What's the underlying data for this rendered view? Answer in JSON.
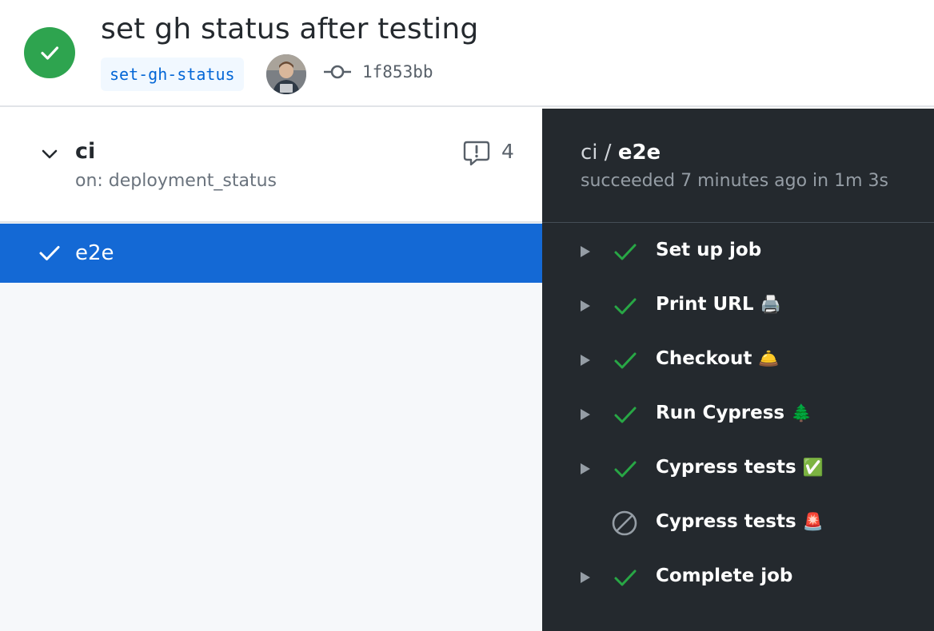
{
  "run": {
    "title": "set gh status after testing",
    "branch": "set-gh-status",
    "commit_sha": "1f853bb",
    "status": "success",
    "status_color": "#2ea44f"
  },
  "workflow": {
    "name": "ci",
    "trigger": "on: deployment_status",
    "annotation_count": "4",
    "jobs": [
      {
        "name": "e2e",
        "status": "success",
        "selected": true
      }
    ]
  },
  "job_detail": {
    "workflow_name": "ci",
    "separator": "/",
    "job_name": "e2e",
    "summary": "succeeded 7 minutes ago in 1m 3s",
    "steps": [
      {
        "name": "Set up job",
        "emoji": "",
        "status": "success",
        "expandable": true
      },
      {
        "name": "Print URL",
        "emoji": "🖨️",
        "status": "success",
        "expandable": true
      },
      {
        "name": "Checkout",
        "emoji": "🛎️",
        "status": "success",
        "expandable": true
      },
      {
        "name": "Run Cypress",
        "emoji": "🌲",
        "status": "success",
        "expandable": true
      },
      {
        "name": "Cypress tests",
        "emoji": "✅",
        "status": "success",
        "expandable": true
      },
      {
        "name": "Cypress tests",
        "emoji": "🚨",
        "status": "skipped",
        "expandable": false
      },
      {
        "name": "Complete job",
        "emoji": "",
        "status": "success",
        "expandable": true
      }
    ]
  },
  "colors": {
    "accent_blue": "#1469d5",
    "success_green": "#2ea44f",
    "dark_panel": "#24292e",
    "branch_text": "#0366d6"
  },
  "icons": {
    "run_status": "check-circle-icon",
    "commit": "git-commit-icon",
    "collapse": "chevron-down-icon",
    "annotations": "comment-alert-icon",
    "step_expand": "triangle-right-icon",
    "step_success": "check-icon",
    "step_skipped": "skip-circle-icon"
  }
}
